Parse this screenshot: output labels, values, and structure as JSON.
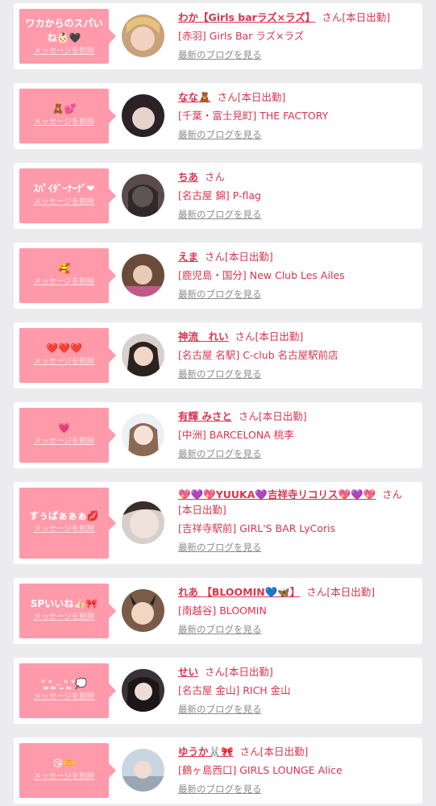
{
  "delete_label": "メッセージを削除",
  "san_label": "さん",
  "blog_label": "最新のブログを見る",
  "colors": {
    "accent": "#d9354f",
    "bubble": "#ff9aaa",
    "background": "#ececef"
  },
  "items": [
    {
      "message": "ワカからのスパいね👶🏻🖤",
      "name": "わか【Girls barラズ×ラズ】",
      "status": "[本日出勤]",
      "shop": "[赤羽] Girls Bar ラズ×ラズ"
    },
    {
      "message": "🧸💕",
      "name": "なな🧸",
      "status": "[本日出勤]",
      "shop": "[千葉・富士見町] THE FACTORY"
    },
    {
      "message": "ｽﾊﾟｲﾀﾞｰﾅｰﾅﾞ❤︎",
      "name": "ちあ",
      "status": "",
      "shop": "[名古屋 錦] P-flag"
    },
    {
      "message": "🥰",
      "name": "えま",
      "status": "[本日出勤]",
      "shop": "[鹿児島・国分] New Club Les Ailes"
    },
    {
      "message": "❤️❤️❤️",
      "name": "神流　れい",
      "status": "[本日出勤]",
      "shop": "[名古屋 名駅] C-club 名古屋駅前店"
    },
    {
      "message": "💗",
      "name": "有輝 みさと",
      "status": "[本日出勤]",
      "shop": "[中洲] BARCELONA 桃李"
    },
    {
      "message": "すぅぱぁぁぁ💋",
      "name": "💖💜💖YUUKA💜吉祥寺リコリス💖💜💖",
      "status": "[本日出勤]",
      "shop": "[吉祥寺駅前] GIRL'S BAR LyCoris"
    },
    {
      "message": "SPいいね👍🏻🎀",
      "name": "れあ 【BLOOMIN💙🦋】",
      "status": "[本日出勤]",
      "shop": "[南越谷] BLOOMIN"
    },
    {
      "message": "ᐡ ̳ᐢ ̳₋ ̫ᐢ ̳ᐡ💭",
      "name": "せい",
      "status": "[本日出勤]",
      "shop": "[名古屋 金山] RICH 金山"
    },
    {
      "message": "😘🫶",
      "name": "ゆうか🐰🎀",
      "status": "[本日出勤]",
      "shop": "[鶴ヶ島西口] GIRLS LOUNGE Alice"
    }
  ]
}
